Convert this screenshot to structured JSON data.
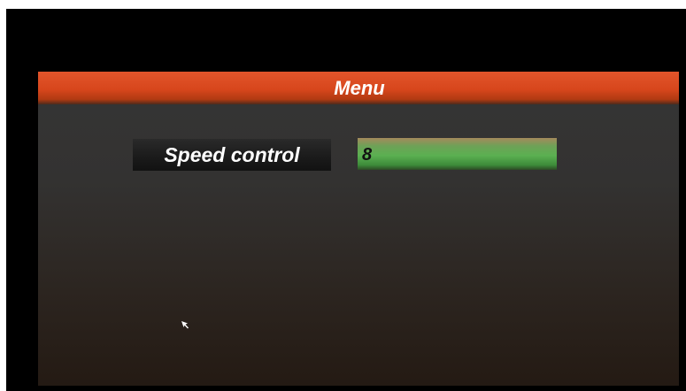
{
  "menu": {
    "title": "Menu"
  },
  "settings": [
    {
      "label": "Speed control",
      "value": "8"
    }
  ],
  "colors": {
    "header": "#d7461c",
    "value_field": "#5bb051",
    "background": "#000000",
    "panel": "#333231"
  },
  "icons": {
    "cursor": "mouse-pointer-icon"
  }
}
